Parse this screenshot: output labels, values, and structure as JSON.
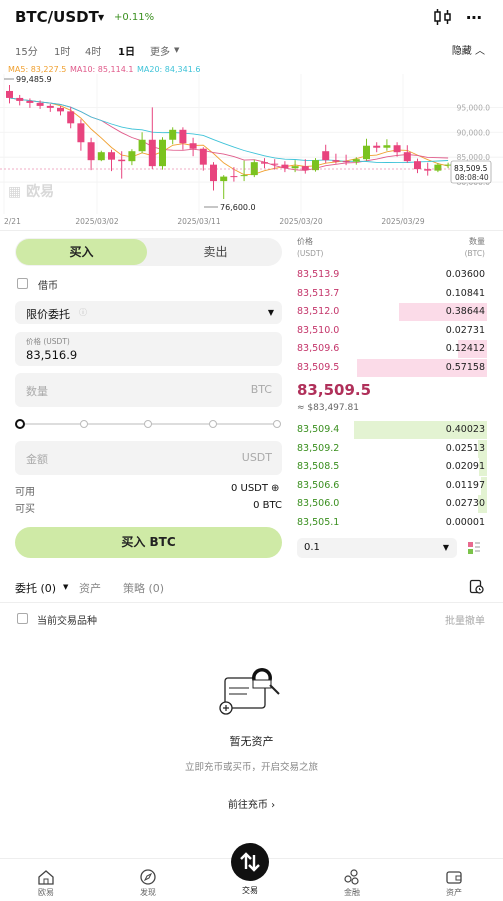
{
  "header": {
    "pair": "BTC/USDT",
    "change": "+0.11%",
    "more_icon": "more-dots-icon",
    "chart_settings_icon": "candlestick-settings-icon"
  },
  "timeframes": {
    "items": [
      "15分",
      "1时",
      "4时",
      "1日",
      "更多"
    ],
    "selected": "1日",
    "hide_label": "隐藏"
  },
  "chart": {
    "ma_labels": [
      "MA5: 83,227.5",
      "MA10: 85,114.1",
      "MA20: 84,341.6"
    ],
    "ma_colors": [
      "#f0a030",
      "#e05a8a",
      "#3fc3d8"
    ],
    "watermark": "欧易",
    "high_label": "99,485.9",
    "low_label": "76,600.0",
    "price_tag": "83,509.5",
    "countdown": "08:08:40",
    "date_labels": [
      "2/21",
      "2025/03/02",
      "2025/03/11",
      "2025/03/20",
      "2025/03/29"
    ]
  },
  "chart_data": {
    "type": "candlestick",
    "y_ticks": [
      "95,000.0",
      "90,000.0",
      "85,000.0",
      "80,000.0"
    ],
    "ylim": [
      76000,
      100500
    ],
    "candles": [
      {
        "o": 98300,
        "h": 99485.9,
        "c": 96900,
        "l": 95800,
        "dir": "down"
      },
      {
        "o": 96900,
        "h": 97500,
        "c": 96300,
        "l": 95400,
        "dir": "down"
      },
      {
        "o": 96300,
        "h": 96800,
        "c": 95900,
        "l": 94900,
        "dir": "down"
      },
      {
        "o": 95900,
        "h": 96400,
        "c": 95300,
        "l": 94700,
        "dir": "down"
      },
      {
        "o": 95300,
        "h": 95700,
        "c": 94900,
        "l": 94100,
        "dir": "down"
      },
      {
        "o": 94900,
        "h": 95300,
        "c": 94200,
        "l": 93400,
        "dir": "down"
      },
      {
        "o": 94200,
        "h": 95100,
        "c": 91800,
        "l": 90800,
        "dir": "down"
      },
      {
        "o": 91800,
        "h": 92600,
        "c": 88000,
        "l": 86300,
        "dir": "down"
      },
      {
        "o": 88000,
        "h": 88900,
        "c": 84400,
        "l": 82400,
        "dir": "down"
      },
      {
        "o": 84400,
        "h": 86300,
        "c": 86000,
        "l": 84200,
        "dir": "up"
      },
      {
        "o": 86000,
        "h": 86500,
        "c": 84500,
        "l": 82200,
        "dir": "down"
      },
      {
        "o": 84500,
        "h": 86200,
        "c": 84200,
        "l": 80700,
        "dir": "down"
      },
      {
        "o": 84200,
        "h": 86600,
        "c": 86200,
        "l": 83400,
        "dir": "up"
      },
      {
        "o": 86200,
        "h": 90000,
        "c": 88500,
        "l": 85800,
        "dir": "up"
      },
      {
        "o": 88500,
        "h": 95000,
        "c": 83200,
        "l": 82600,
        "dir": "down"
      },
      {
        "o": 83200,
        "h": 89000,
        "c": 88500,
        "l": 82500,
        "dir": "up"
      },
      {
        "o": 88500,
        "h": 91000,
        "c": 90500,
        "l": 87600,
        "dir": "up"
      },
      {
        "o": 90500,
        "h": 91000,
        "c": 87800,
        "l": 86500,
        "dir": "down"
      },
      {
        "o": 87800,
        "h": 88900,
        "c": 86700,
        "l": 85200,
        "dir": "down"
      },
      {
        "o": 86700,
        "h": 87000,
        "c": 83500,
        "l": 82300,
        "dir": "down"
      },
      {
        "o": 83500,
        "h": 84000,
        "c": 80200,
        "l": 78300,
        "dir": "down"
      },
      {
        "o": 80200,
        "h": 81400,
        "c": 81100,
        "l": 76600,
        "dir": "up"
      },
      {
        "o": 81100,
        "h": 83000,
        "c": 81200,
        "l": 80100,
        "dir": "down"
      },
      {
        "o": 81200,
        "h": 84300,
        "c": 81400,
        "l": 80200,
        "dir": "up"
      },
      {
        "o": 81400,
        "h": 84500,
        "c": 84000,
        "l": 81000,
        "dir": "up"
      },
      {
        "o": 84000,
        "h": 84800,
        "c": 83700,
        "l": 82800,
        "dir": "down"
      },
      {
        "o": 83700,
        "h": 84600,
        "c": 83500,
        "l": 82500,
        "dir": "down"
      },
      {
        "o": 83500,
        "h": 84200,
        "c": 82800,
        "l": 82000,
        "dir": "down"
      },
      {
        "o": 82800,
        "h": 84400,
        "c": 83200,
        "l": 82000,
        "dir": "up"
      },
      {
        "o": 83200,
        "h": 84600,
        "c": 82400,
        "l": 81700,
        "dir": "down"
      },
      {
        "o": 82400,
        "h": 84800,
        "c": 84400,
        "l": 82100,
        "dir": "up"
      },
      {
        "o": 84400,
        "h": 87500,
        "c": 86200,
        "l": 83800,
        "dir": "down"
      },
      {
        "o": 84400,
        "h": 85700,
        "c": 84100,
        "l": 83700,
        "dir": "down"
      },
      {
        "o": 84100,
        "h": 85500,
        "c": 84200,
        "l": 83400,
        "dir": "down"
      },
      {
        "o": 84100,
        "h": 85000,
        "c": 84600,
        "l": 83500,
        "dir": "up"
      },
      {
        "o": 84600,
        "h": 88700,
        "c": 87300,
        "l": 84300,
        "dir": "up"
      },
      {
        "o": 87300,
        "h": 88000,
        "c": 86900,
        "l": 86000,
        "dir": "down"
      },
      {
        "o": 86900,
        "h": 88600,
        "c": 87400,
        "l": 86300,
        "dir": "up"
      },
      {
        "o": 87400,
        "h": 88000,
        "c": 86000,
        "l": 85100,
        "dir": "down"
      },
      {
        "o": 86000,
        "h": 87400,
        "c": 84200,
        "l": 83900,
        "dir": "down"
      },
      {
        "o": 84200,
        "h": 84700,
        "c": 82600,
        "l": 81800,
        "dir": "down"
      },
      {
        "o": 82600,
        "h": 83900,
        "c": 82300,
        "l": 81300,
        "dir": "down"
      },
      {
        "o": 82300,
        "h": 83800,
        "c": 83500,
        "l": 82000,
        "dir": "up"
      },
      {
        "o": 83500,
        "h": 83900,
        "c": 83509.5,
        "l": 82800,
        "dir": "up"
      }
    ]
  },
  "order_form": {
    "tab_buy": "买入",
    "tab_sell": "卖出",
    "margin_label": "借币",
    "order_type": "限价委托",
    "price_label": "价格 (USDT)",
    "price_value": "83,516.9",
    "amount_placeholder": "数量",
    "amount_unit": "BTC",
    "total_placeholder": "金额",
    "total_unit": "USDT",
    "available_label": "可用",
    "available_value": "0 USDT",
    "canbuy_label": "可买",
    "canbuy_value": "0 BTC",
    "submit_label": "买入 BTC",
    "slider_percent": 0
  },
  "orderbook": {
    "price_header": "价格",
    "price_unit": "(USDT)",
    "qty_header": "数量",
    "qty_unit": "(BTC)",
    "asks": [
      {
        "price": "83,513.9",
        "qty": "0.03600",
        "depth": 0.0
      },
      {
        "price": "83,513.7",
        "qty": "0.10841",
        "depth": 0.0
      },
      {
        "price": "83,512.0",
        "qty": "0.38644",
        "depth": 0.68
      },
      {
        "price": "83,510.0",
        "qty": "0.02731",
        "depth": 0.0
      },
      {
        "price": "83,509.6",
        "qty": "0.12412",
        "depth": 0.22
      },
      {
        "price": "83,509.5",
        "qty": "0.57158",
        "depth": 1.0
      }
    ],
    "last_price": "83,509.5",
    "last_usd": "≈ $83,497.81",
    "bids": [
      {
        "price": "83,509.4",
        "qty": "0.40023",
        "depth": 0.7
      },
      {
        "price": "83,509.2",
        "qty": "0.02513",
        "depth": 0.05
      },
      {
        "price": "83,508.5",
        "qty": "0.02091",
        "depth": 0.04
      },
      {
        "price": "83,506.6",
        "qty": "0.01197",
        "depth": 0.03
      },
      {
        "price": "83,506.0",
        "qty": "0.02730",
        "depth": 0.05
      },
      {
        "price": "83,505.1",
        "qty": "0.00001",
        "depth": 0.0
      }
    ],
    "depth_value": "0.1"
  },
  "orders": {
    "tabs": [
      "委托 (0)",
      "资产",
      "策略 (0)"
    ],
    "current_pair_label": "当前交易品种",
    "batch_cancel": "批量撤单",
    "empty_title": "暂无资产",
    "empty_sub": "立即充币或买币，开启交易之旅",
    "empty_link": "前往充币"
  },
  "nav": {
    "items": [
      "欧易",
      "发现",
      "交易",
      "金融",
      "资产"
    ]
  }
}
